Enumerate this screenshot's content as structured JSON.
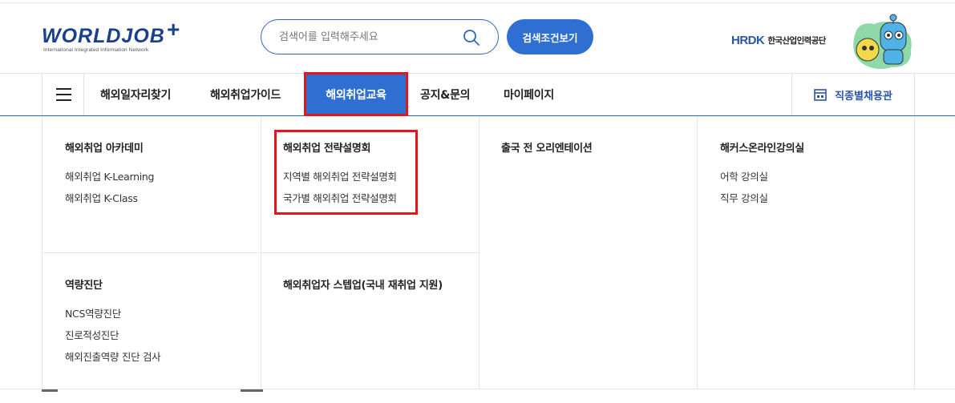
{
  "header": {
    "logo_text": "WORLDJOB",
    "logo_plus": "+",
    "logo_subtitle": "International Integrated Information Network",
    "search_placeholder": "검색어를 입력해주세요",
    "search_button_label": "검색조건보기",
    "org_logo": "HRDK",
    "org_name": "한국산업인력공단"
  },
  "nav": {
    "items": [
      {
        "label": "해외일자리찾기"
      },
      {
        "label": "해외취업가이드"
      },
      {
        "label": "해외취업교육",
        "active": true
      },
      {
        "label": "공지&문의"
      },
      {
        "label": "마이페이지"
      }
    ],
    "right_label": "직종별채용관"
  },
  "mega_menu": {
    "sections": [
      {
        "title": "해외취업 아카데미",
        "links": [
          "해외취업 K-Learning",
          "해외취업 K-Class"
        ]
      },
      {
        "title": "해외취업 전략설명회",
        "links": [
          "지역별 해외취업 전략설명회",
          "국가별 해외취업 전략설명회"
        ],
        "highlighted": true
      },
      {
        "title": "출국 전 오리엔테이션",
        "links": []
      },
      {
        "title": "해커스온라인강의실",
        "links": [
          "어학 강의실",
          "직무 강의실"
        ]
      },
      {
        "title": "역량진단",
        "links": [
          "NCS역량진단",
          "진로적성진단",
          "해외진출역량 진단 검사"
        ]
      },
      {
        "title": "해외취업자 스텝업(국내 재취업 지원)",
        "links": []
      }
    ]
  },
  "colors": {
    "primary": "#2f6fd1",
    "highlight": "#e0171f",
    "brand_dark": "#1b3f8f"
  }
}
